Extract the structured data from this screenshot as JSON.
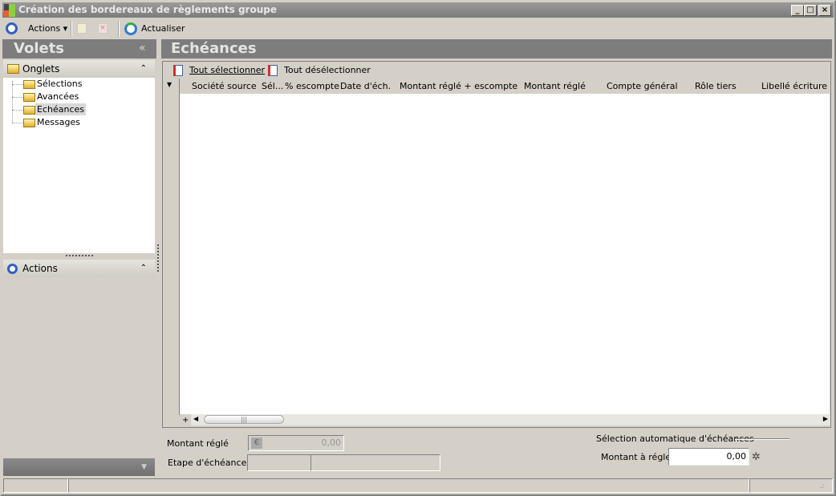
{
  "window": {
    "title": "Création des bordereaux de règlements groupe",
    "controls": [
      "_",
      "□",
      "×"
    ]
  },
  "toolbar": {
    "actions_label": "Actions",
    "refresh_label": "Actualiser"
  },
  "left_pane": {
    "title": "Volets",
    "collapse": "«",
    "tabs_section": {
      "label": "Onglets",
      "items": [
        {
          "label": "Sélections"
        },
        {
          "label": "Avancées"
        },
        {
          "label": "Echéances",
          "selected": true
        },
        {
          "label": "Messages"
        }
      ]
    },
    "actions_section": {
      "label": "Actions"
    }
  },
  "main": {
    "title": "Echéances",
    "select_all": "Tout sélectionner",
    "deselect_all": "Tout désélectionner",
    "columns": [
      "Société source",
      "Sél...",
      "% escompte",
      "Date d'éch.",
      "Montant réglé + escompte",
      "Montant réglé",
      "Compte général",
      "Rôle tiers",
      "Libellé écriture"
    ],
    "rows": []
  },
  "form": {
    "amount_paid_label": "Montant réglé",
    "amount_paid_value": "0,00",
    "step_label": "Etape d'échéances",
    "auto_group_label": "Sélection automatique d'échéances",
    "amount_to_pay_label": "Montant à régler",
    "amount_to_pay_value": "0,00"
  },
  "colors": {
    "header": "#7d7d7d",
    "accent": "#3060c0"
  }
}
